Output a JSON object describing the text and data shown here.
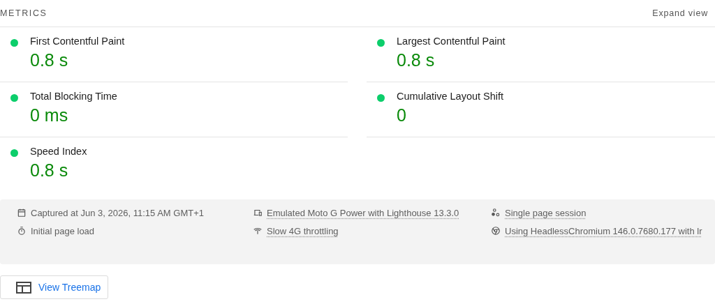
{
  "header": {
    "title": "METRICS",
    "toggle": "Expand view"
  },
  "metrics": [
    {
      "label": "First Contentful Paint",
      "value": "0.8 s",
      "color": "#0cce6b"
    },
    {
      "label": "Largest Contentful Paint",
      "value": "0.8 s",
      "color": "#0cce6b"
    },
    {
      "label": "Total Blocking Time",
      "value": "0 ms",
      "color": "#0cce6b"
    },
    {
      "label": "Cumulative Layout Shift",
      "value": "0",
      "color": "#0cce6b"
    },
    {
      "label": "Speed Index",
      "value": "0.8 s",
      "color": "#0cce6b"
    }
  ],
  "runtime_settings": [
    [
      {
        "text": "Captured at Jun 3, 2026, 11:15 AM GMT+1",
        "kind": "plain"
      },
      {
        "text": "Initial page load",
        "kind": "plain"
      }
    ],
    [
      {
        "text": "Emulated Moto G Power with Lighthouse 13.3.0",
        "kind": "link"
      },
      {
        "text": "Slow 4G throttling",
        "kind": "link"
      }
    ],
    [
      {
        "text": "Single page session",
        "kind": "link"
      },
      {
        "text": "Using HeadlessChromium 146.0.7680.177 with lr",
        "kind": "link"
      }
    ]
  ],
  "treemap_button": "View Treemap"
}
